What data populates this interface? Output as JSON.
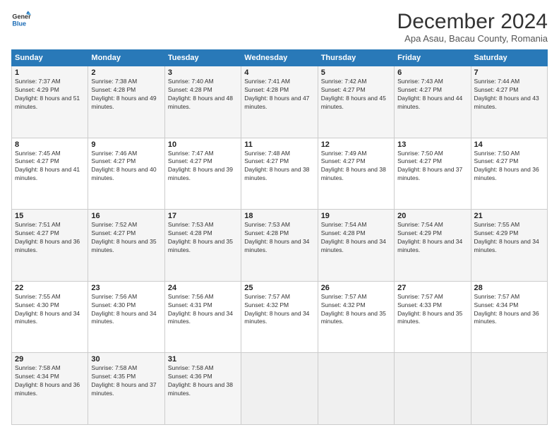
{
  "logo": {
    "line1": "General",
    "line2": "Blue"
  },
  "title": "December 2024",
  "subtitle": "Apa Asau, Bacau County, Romania",
  "weekdays": [
    "Sunday",
    "Monday",
    "Tuesday",
    "Wednesday",
    "Thursday",
    "Friday",
    "Saturday"
  ],
  "weeks": [
    [
      {
        "day": "1",
        "sunrise": "7:37 AM",
        "sunset": "4:29 PM",
        "daylight": "8 hours and 51 minutes."
      },
      {
        "day": "2",
        "sunrise": "7:38 AM",
        "sunset": "4:28 PM",
        "daylight": "8 hours and 49 minutes."
      },
      {
        "day": "3",
        "sunrise": "7:40 AM",
        "sunset": "4:28 PM",
        "daylight": "8 hours and 48 minutes."
      },
      {
        "day": "4",
        "sunrise": "7:41 AM",
        "sunset": "4:28 PM",
        "daylight": "8 hours and 47 minutes."
      },
      {
        "day": "5",
        "sunrise": "7:42 AM",
        "sunset": "4:27 PM",
        "daylight": "8 hours and 45 minutes."
      },
      {
        "day": "6",
        "sunrise": "7:43 AM",
        "sunset": "4:27 PM",
        "daylight": "8 hours and 44 minutes."
      },
      {
        "day": "7",
        "sunrise": "7:44 AM",
        "sunset": "4:27 PM",
        "daylight": "8 hours and 43 minutes."
      }
    ],
    [
      {
        "day": "8",
        "sunrise": "7:45 AM",
        "sunset": "4:27 PM",
        "daylight": "8 hours and 41 minutes."
      },
      {
        "day": "9",
        "sunrise": "7:46 AM",
        "sunset": "4:27 PM",
        "daylight": "8 hours and 40 minutes."
      },
      {
        "day": "10",
        "sunrise": "7:47 AM",
        "sunset": "4:27 PM",
        "daylight": "8 hours and 39 minutes."
      },
      {
        "day": "11",
        "sunrise": "7:48 AM",
        "sunset": "4:27 PM",
        "daylight": "8 hours and 38 minutes."
      },
      {
        "day": "12",
        "sunrise": "7:49 AM",
        "sunset": "4:27 PM",
        "daylight": "8 hours and 38 minutes."
      },
      {
        "day": "13",
        "sunrise": "7:50 AM",
        "sunset": "4:27 PM",
        "daylight": "8 hours and 37 minutes."
      },
      {
        "day": "14",
        "sunrise": "7:50 AM",
        "sunset": "4:27 PM",
        "daylight": "8 hours and 36 minutes."
      }
    ],
    [
      {
        "day": "15",
        "sunrise": "7:51 AM",
        "sunset": "4:27 PM",
        "daylight": "8 hours and 36 minutes."
      },
      {
        "day": "16",
        "sunrise": "7:52 AM",
        "sunset": "4:27 PM",
        "daylight": "8 hours and 35 minutes."
      },
      {
        "day": "17",
        "sunrise": "7:53 AM",
        "sunset": "4:28 PM",
        "daylight": "8 hours and 35 minutes."
      },
      {
        "day": "18",
        "sunrise": "7:53 AM",
        "sunset": "4:28 PM",
        "daylight": "8 hours and 34 minutes."
      },
      {
        "day": "19",
        "sunrise": "7:54 AM",
        "sunset": "4:28 PM",
        "daylight": "8 hours and 34 minutes."
      },
      {
        "day": "20",
        "sunrise": "7:54 AM",
        "sunset": "4:29 PM",
        "daylight": "8 hours and 34 minutes."
      },
      {
        "day": "21",
        "sunrise": "7:55 AM",
        "sunset": "4:29 PM",
        "daylight": "8 hours and 34 minutes."
      }
    ],
    [
      {
        "day": "22",
        "sunrise": "7:55 AM",
        "sunset": "4:30 PM",
        "daylight": "8 hours and 34 minutes."
      },
      {
        "day": "23",
        "sunrise": "7:56 AM",
        "sunset": "4:30 PM",
        "daylight": "8 hours and 34 minutes."
      },
      {
        "day": "24",
        "sunrise": "7:56 AM",
        "sunset": "4:31 PM",
        "daylight": "8 hours and 34 minutes."
      },
      {
        "day": "25",
        "sunrise": "7:57 AM",
        "sunset": "4:32 PM",
        "daylight": "8 hours and 34 minutes."
      },
      {
        "day": "26",
        "sunrise": "7:57 AM",
        "sunset": "4:32 PM",
        "daylight": "8 hours and 35 minutes."
      },
      {
        "day": "27",
        "sunrise": "7:57 AM",
        "sunset": "4:33 PM",
        "daylight": "8 hours and 35 minutes."
      },
      {
        "day": "28",
        "sunrise": "7:57 AM",
        "sunset": "4:34 PM",
        "daylight": "8 hours and 36 minutes."
      }
    ],
    [
      {
        "day": "29",
        "sunrise": "7:58 AM",
        "sunset": "4:34 PM",
        "daylight": "8 hours and 36 minutes."
      },
      {
        "day": "30",
        "sunrise": "7:58 AM",
        "sunset": "4:35 PM",
        "daylight": "8 hours and 37 minutes."
      },
      {
        "day": "31",
        "sunrise": "7:58 AM",
        "sunset": "4:36 PM",
        "daylight": "8 hours and 38 minutes."
      },
      null,
      null,
      null,
      null
    ]
  ]
}
